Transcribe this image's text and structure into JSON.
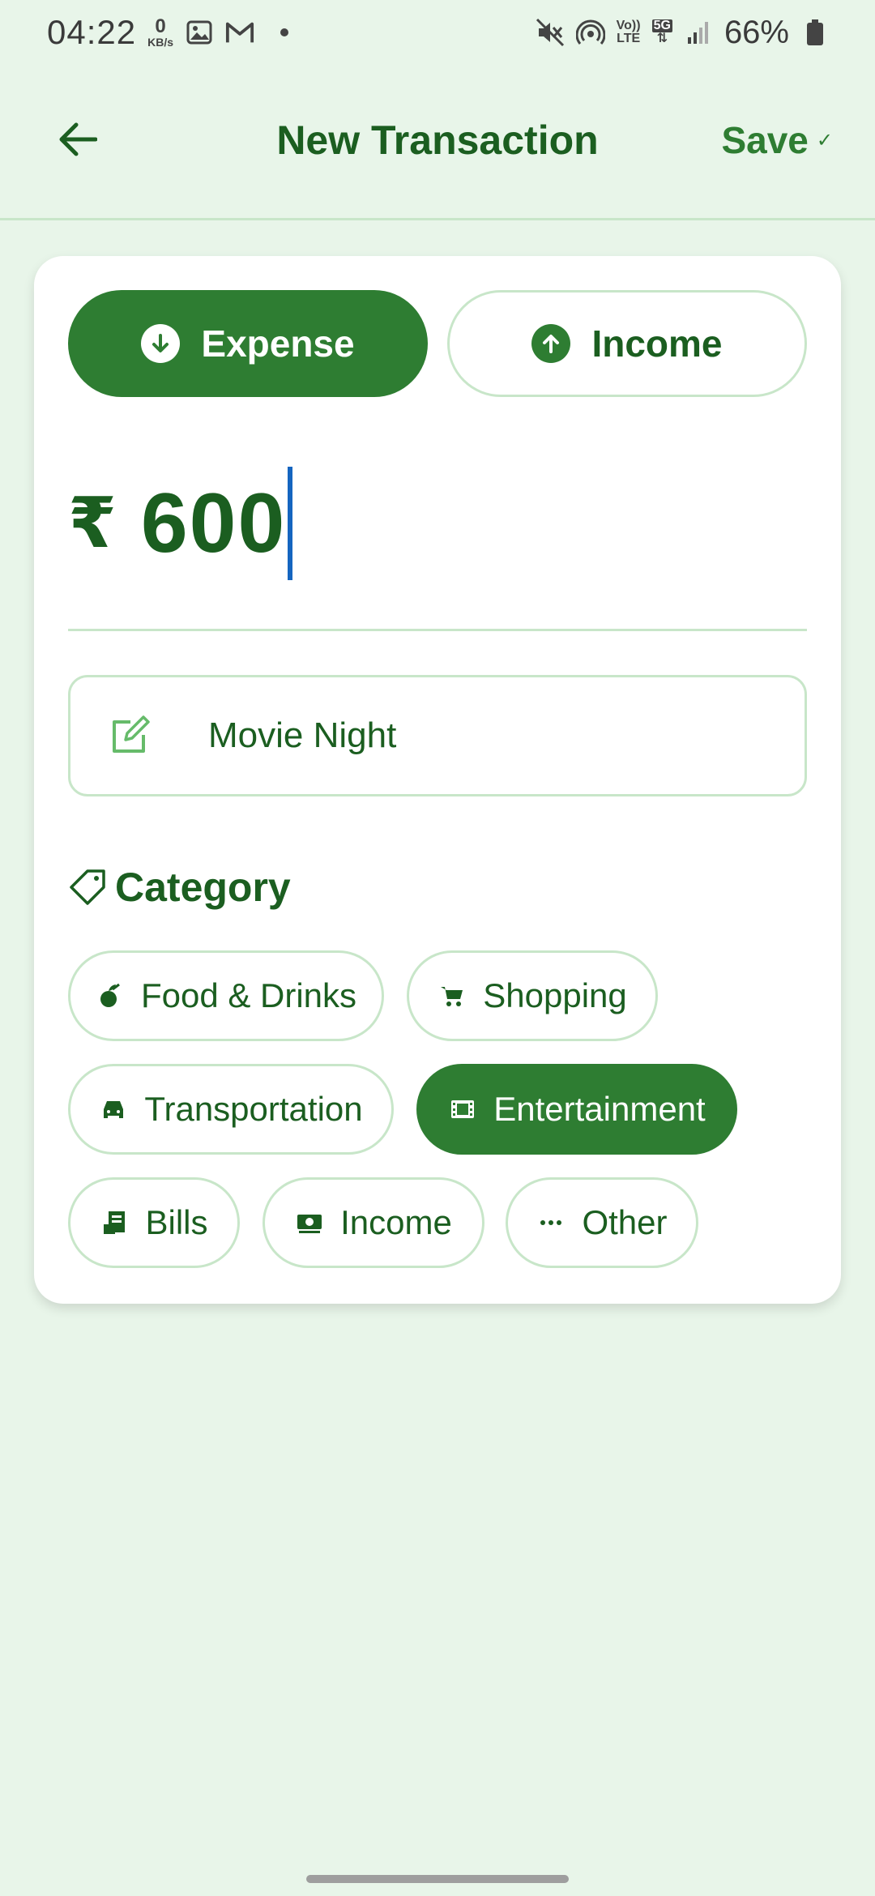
{
  "status_bar": {
    "time": "04:22",
    "net_speed_value": "0",
    "net_speed_unit": "KB/s",
    "net_type_top": "Vo))",
    "net_type_bottom": "LTE",
    "net_gen": "5G",
    "battery": "66%"
  },
  "app_bar": {
    "title": "New Transaction",
    "save_label": "Save",
    "save_check": "✓"
  },
  "type_toggle": {
    "expense_label": "Expense",
    "income_label": "Income",
    "selected": "Expense"
  },
  "amount": {
    "currency": "₹",
    "value": "600"
  },
  "note": {
    "value": "Movie Night"
  },
  "category": {
    "title": "Category",
    "selected": "Entertainment",
    "chips": [
      {
        "label": "Food & Drinks",
        "icon": "food-icon"
      },
      {
        "label": "Shopping",
        "icon": "cart-icon"
      },
      {
        "label": "Transportation",
        "icon": "car-icon"
      },
      {
        "label": "Entertainment",
        "icon": "film-icon"
      },
      {
        "label": "Bills",
        "icon": "receipt-icon"
      },
      {
        "label": "Income",
        "icon": "money-icon"
      },
      {
        "label": "Other",
        "icon": "more-icon"
      }
    ]
  },
  "colors": {
    "primary": "#2e7d32",
    "primary_dark": "#1b5e20",
    "background": "#e8f5e9",
    "border": "#c8e6c9"
  }
}
